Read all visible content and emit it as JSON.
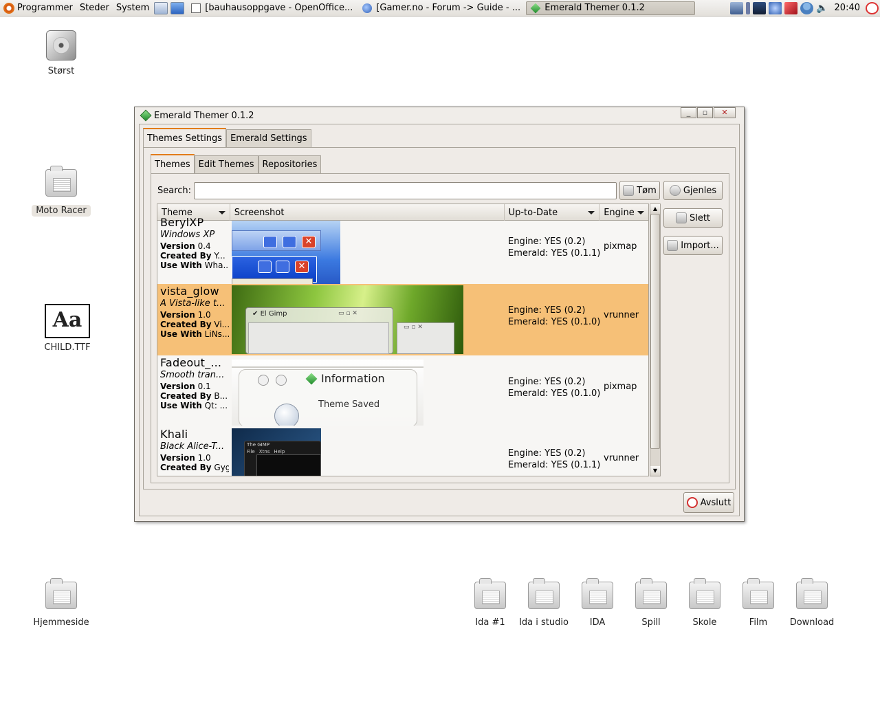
{
  "panel": {
    "menus": [
      "Programmer",
      "Steder",
      "System"
    ],
    "tasks": [
      {
        "label": "[bauhausoppgave - OpenOffice...",
        "active": false
      },
      {
        "label": "[Gamer.no - Forum -> Guide - ...",
        "active": false
      },
      {
        "label": "Emerald Themer 0.1.2",
        "active": true
      }
    ],
    "clock": "20:40"
  },
  "desktop": {
    "icons": [
      {
        "label": "Størst"
      },
      {
        "label": "Moto Racer"
      },
      {
        "label": "CHILD.TTF"
      },
      {
        "label": "Hjemmeside"
      },
      {
        "label": "Ida #1"
      },
      {
        "label": "Ida i studio"
      },
      {
        "label": "IDA"
      },
      {
        "label": "Spill"
      },
      {
        "label": "Skole"
      },
      {
        "label": "Film"
      },
      {
        "label": "Download"
      }
    ]
  },
  "window": {
    "title": "Emerald Themer 0.1.2",
    "outer_tabs": [
      "Themes Settings",
      "Emerald Settings"
    ],
    "inner_tabs": [
      "Themes",
      "Edit Themes",
      "Repositories"
    ],
    "search_label": "Search:",
    "search_value": "",
    "buttons": {
      "clear": "Tøm",
      "reload": "Gjenles",
      "delete": "Slett",
      "import": "Import...",
      "quit": "Avslutt"
    },
    "columns": [
      "Theme",
      "Screenshot",
      "Up-to-Date",
      "Engine"
    ],
    "labels": {
      "version": "Version",
      "created_by": "Created By",
      "use_with": "Use With"
    },
    "themes": [
      {
        "name": "BerylXP",
        "desc": "Windows XP",
        "version": "0.4",
        "created_by": "Y...",
        "use_with": "Wha...",
        "engine_status": "Engine: YES (0.2)",
        "emerald_status": "Emerald: YES (0.1.1)",
        "engine": "pixmap",
        "selected": false
      },
      {
        "name": "vista_glow",
        "desc": "A Vista-like t...",
        "version": "1.0",
        "created_by": "Vi...",
        "use_with": "LiNs...",
        "engine_status": "Engine: YES (0.2)",
        "emerald_status": "Emerald: YES (0.1.0)",
        "engine": "vrunner",
        "selected": true
      },
      {
        "name": "Fadeout_...",
        "desc": "Smooth tran...",
        "version": "0.1",
        "created_by": "B...",
        "use_with": "Qt: ...",
        "engine_status": "Engine: YES (0.2)",
        "emerald_status": "Emerald: YES (0.1.0)",
        "engine": "pixmap",
        "selected": false
      },
      {
        "name": "Khali",
        "desc": "Black Alice-T...",
        "version": "1.0",
        "created_by": "Gyg",
        "use_with": "",
        "engine_status": "Engine: YES (0.2)",
        "emerald_status": "Emerald: YES (0.1.1)",
        "engine": "vrunner",
        "selected": false
      }
    ],
    "screenshot_texts": {
      "vista_window": "El Gimp",
      "fadeout_title": "Information",
      "fadeout_msg": "Theme Saved",
      "khali_title": "The GIMP",
      "khali_menu": [
        "File",
        "Xtns",
        "Help"
      ]
    }
  }
}
